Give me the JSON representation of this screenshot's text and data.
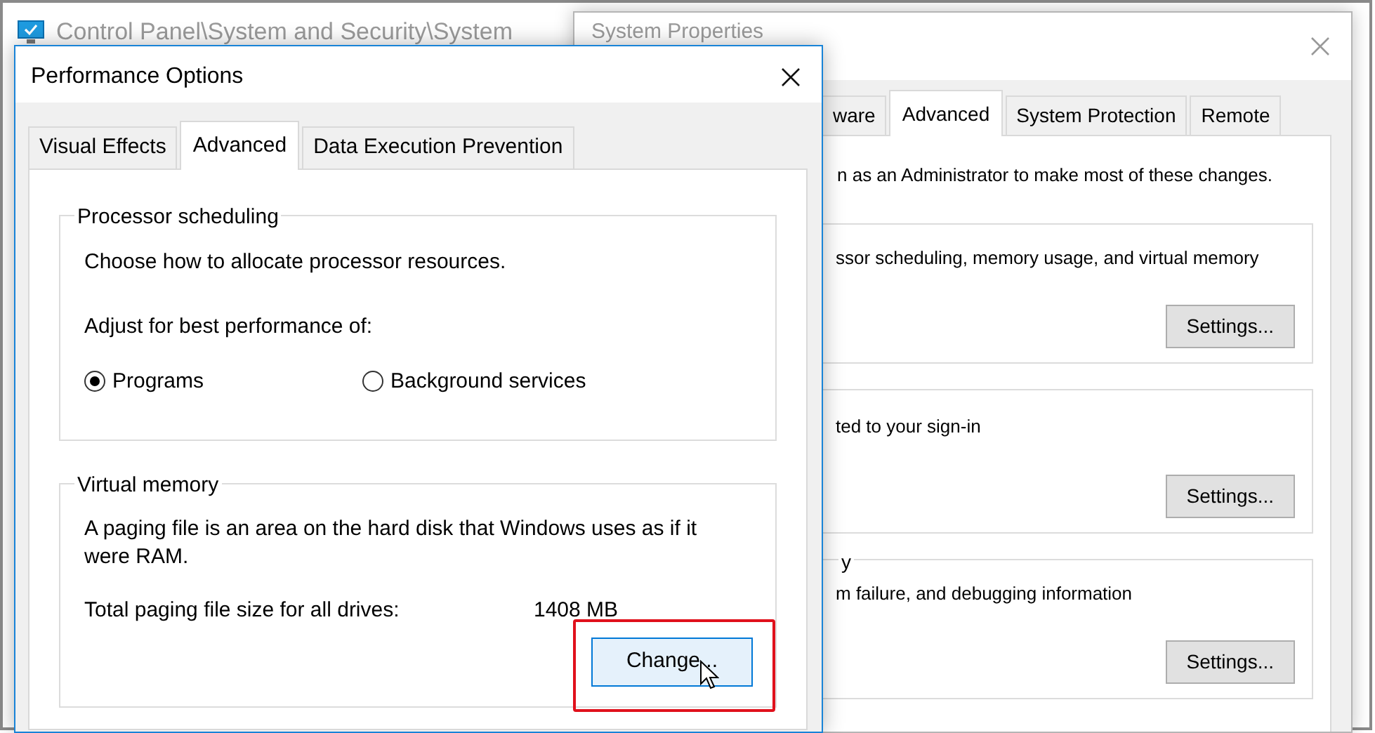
{
  "background_window": {
    "title": "Control Panel\\System and Security\\System"
  },
  "system_properties": {
    "title": "System Properties",
    "tabs": [
      {
        "label": "ware",
        "selected": false
      },
      {
        "label": "Advanced",
        "selected": true
      },
      {
        "label": "System Protection",
        "selected": false
      },
      {
        "label": "Remote",
        "selected": false
      }
    ],
    "notice": "n as an Administrator to make most of these changes.",
    "groups": [
      {
        "description": "ssor scheduling, memory usage, and virtual memory",
        "button": "Settings..."
      },
      {
        "description": "ted to your sign-in",
        "button": "Settings..."
      },
      {
        "title": "y",
        "description": "m failure, and debugging information",
        "button": "Settings..."
      }
    ]
  },
  "performance_options": {
    "title": "Performance Options",
    "tabs": [
      {
        "label": "Visual Effects",
        "selected": false
      },
      {
        "label": "Advanced",
        "selected": true
      },
      {
        "label": "Data Execution Prevention",
        "selected": false
      }
    ],
    "processor_scheduling": {
      "title": "Processor scheduling",
      "description": "Choose how to allocate processor resources.",
      "adjust_label": "Adjust for best performance of:",
      "options": [
        {
          "label": "Programs",
          "selected": true
        },
        {
          "label": "Background services",
          "selected": false
        }
      ]
    },
    "virtual_memory": {
      "title": "Virtual memory",
      "description": "A paging file is an area on the hard disk that Windows uses as if it were RAM.",
      "total_label": "Total paging file size for all drives:",
      "total_value": "1408 MB",
      "button": {
        "label": "Change...",
        "hovered": true,
        "highlighted": true
      }
    }
  }
}
